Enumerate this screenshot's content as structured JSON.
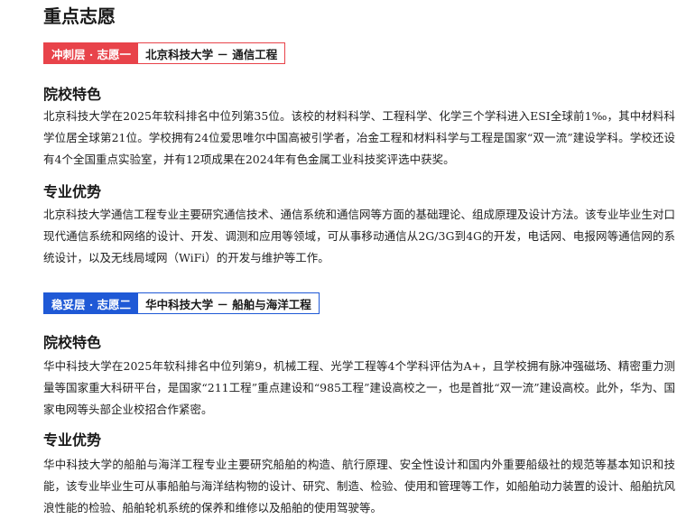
{
  "title": "重点志愿",
  "choices": [
    {
      "tier": "冲刺层 · 志愿一",
      "target": "北京科技大学 － 通信工程",
      "school_heading": "院校特色",
      "school_text": "北京科技大学在2025年软科排名中位列第35位。该校的材料科学、工程科学、化学三个学科进入ESI全球前1‰，其中材料科学位居全球第21位。学校拥有24位爱思唯尔中国高被引学者，冶金工程和材料科学与工程是国家“双一流”建设学科。学校还设有4个全国重点实验室，并有12项成果在2024年有色金属工业科技奖评选中获奖。",
      "major_heading": "专业优势",
      "major_text": "北京科技大学通信工程专业主要研究通信技术、通信系统和通信网等方面的基础理论、组成原理及设计方法。该专业毕业生对口现代通信系统和网络的设计、开发、调测和应用等领域，可从事移动通信从2G/3G到4G的开发，电话网、电报网等通信网的系统设计，以及无线局域网（WiFi）的开发与维护等工作。",
      "color": "#e8434a"
    },
    {
      "tier": "稳妥层 · 志愿二",
      "target": "华中科技大学 － 船舶与海洋工程",
      "school_heading": "院校特色",
      "school_text": "华中科技大学在2025年软科排名中位列第9，机械工程、光学工程等4个学科评估为A+，且学校拥有脉冲强磁场、精密重力测量等国家重大科研平台，是国家“211工程”重点建设和“985工程”建设高校之一，也是首批“双一流”建设高校。此外，华为、国家电网等头部企业校招合作紧密。",
      "major_heading": "专业优势",
      "major_text": "华中科技大学的船舶与海洋工程专业主要研究船舶的构造、航行原理、安全性设计和国内外重要船级社的规范等基本知识和技能，该专业毕业生可从事船舶与海洋结构物的设计、研究、制造、检验、使用和管理等工作，如船舶动力装置的设计、船舶抗风浪性能的检验、船舶轮机系统的保养和维修以及船舶的使用驾驶等。",
      "color": "#1f59d6"
    }
  ]
}
